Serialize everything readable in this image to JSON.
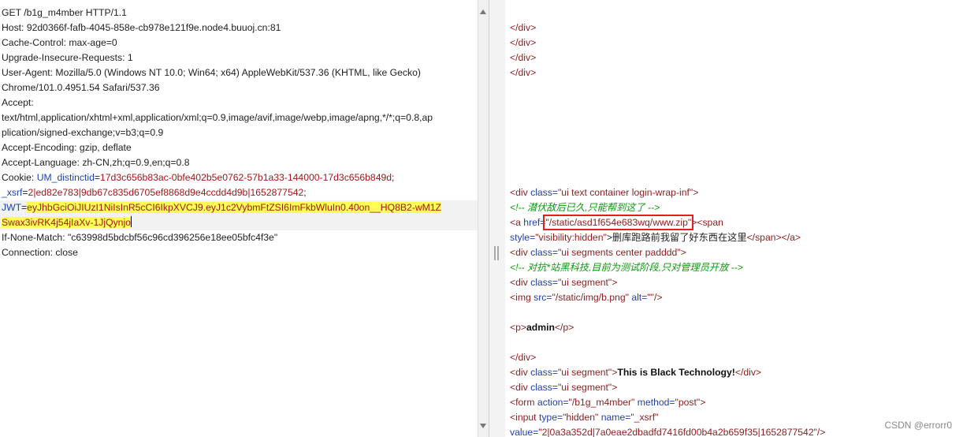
{
  "request": {
    "lines": [
      "GET /b1g_m4mber HTTP/1.1",
      "Host: 92d0366f-fafb-4045-858e-cb978e121f9e.node4.buuoj.cn:81",
      "Cache-Control: max-age=0",
      "Upgrade-Insecure-Requests: 1",
      "User-Agent: Mozilla/5.0 (Windows NT 10.0; Win64; x64) AppleWebKit/537.36 (KHTML, like Gecko)",
      "Chrome/101.0.4951.54 Safari/537.36",
      "Accept:",
      "text/html,application/xhtml+xml,application/xml;q=0.9,image/avif,image/webp,image/apng,*/*;q=0.8,ap",
      "plication/signed-exchange;v=b3;q=0.9",
      "Accept-Encoding: gzip, deflate",
      "Accept-Language: zh-CN,zh;q=0.9,en;q=0.8"
    ],
    "cookie_label": "Cookie: ",
    "cookie_um_key": "UM_distinctid",
    "cookie_um_eq": "=",
    "cookie_um_val": "17d3c656b83ac-0bfe402b5e0762-57b1a33-144000-17d3c656b849d",
    "cookie_semicolon": ";",
    "cookie_xsrf_key": "_xsrf",
    "cookie_xsrf_eq": "=",
    "cookie_xsrf_val": "2|ed82e783|9db67c835d6705ef8868d9e4ccdd4d9b|1652877542",
    "cookie_semicolon2": ";",
    "jwt_key": "JWT",
    "jwt_eq": "=",
    "jwt_val_line1": "eyJhbGciOiJIUzI1NiIsInR5cCI6IkpXVCJ9.eyJ1c2VybmFtZSI6ImFkbWluIn0.40on__HQ8B2-wM1Z",
    "jwt_val_line2": "Swax3ivRK4j54jIaXv-1JjQynjo",
    "if_none_match": "If-None-Match: \"c63998d5bdcbf56c96cd396256e18ee05bfc4f3e\"",
    "connection": "Connection: close"
  },
  "response": {
    "close_div": "</div>",
    "l_div_open": "<div ",
    "l_class": "class=",
    "l_val_login_wrap": "\"ui text container login-wrap-inf\"",
    "l_gt": ">",
    "comment1": "<!-- 潜伏敌后已久,只能帮到这了 -->",
    "a_open": "<a ",
    "href_attr": "href=",
    "href_val": "\"/static/asd1f654e683wq/www.zip\"",
    "span_open": "><span",
    "style_attr": "style=",
    "style_val": "\"visibility:hidden\"",
    "span_text": ">删库跑路前我留了好东西在这里",
    "span_close": "</span></a>",
    "val_segments": "\"ui segments center padddd\"",
    "comment2": "<!-- 对抗*站黑科技,目前为测试阶段,只对管理员开放 -->",
    "val_segment": "\"ui segment\"",
    "img_open": "<img ",
    "src_attr": "src=",
    "src_val": "\"/static/img/b.png\"",
    "alt_attr": " alt=",
    "alt_val": "\"\"",
    "img_close": "/>",
    "p_open": "<p>",
    "admin_text": "admin",
    "p_close": "</p>",
    "black_tech": "This is Black Technology!",
    "form_open": "<form ",
    "action_attr": "action=",
    "action_val": "\"/b1g_m4mber\"",
    "method_attr": " method=",
    "method_val": "\"post\"",
    "input_open": "<input ",
    "type_attr": "type=",
    "type_val": "\"hidden\"",
    "name_attr": " name=",
    "name_val": "\"_xsrf\"",
    "value_attr": "value=",
    "value_val": "\"2|0a3a352d|7a0eae2dbadfd7416fd00b4a2b659f35|1652877542\"/>"
  },
  "watermark": "CSDN @errorr0",
  "colors": {
    "tag": "#8b1d1d",
    "attr": "#2440a6",
    "comment": "#0a9a0a",
    "highlight": "#ffff55",
    "outline": "#e02020"
  }
}
